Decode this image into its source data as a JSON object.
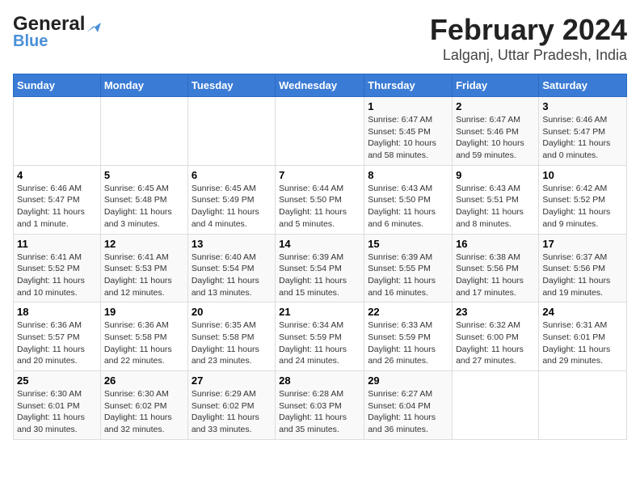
{
  "header": {
    "logo_general": "General",
    "logo_blue": "Blue",
    "title": "February 2024",
    "subtitle": "Lalganj, Uttar Pradesh, India"
  },
  "days_of_week": [
    "Sunday",
    "Monday",
    "Tuesday",
    "Wednesday",
    "Thursday",
    "Friday",
    "Saturday"
  ],
  "weeks": [
    [
      {
        "day": "",
        "info": ""
      },
      {
        "day": "",
        "info": ""
      },
      {
        "day": "",
        "info": ""
      },
      {
        "day": "",
        "info": ""
      },
      {
        "day": "1",
        "info": "Sunrise: 6:47 AM\nSunset: 5:45 PM\nDaylight: 10 hours and 58 minutes."
      },
      {
        "day": "2",
        "info": "Sunrise: 6:47 AM\nSunset: 5:46 PM\nDaylight: 10 hours and 59 minutes."
      },
      {
        "day": "3",
        "info": "Sunrise: 6:46 AM\nSunset: 5:47 PM\nDaylight: 11 hours and 0 minutes."
      }
    ],
    [
      {
        "day": "4",
        "info": "Sunrise: 6:46 AM\nSunset: 5:47 PM\nDaylight: 11 hours and 1 minute."
      },
      {
        "day": "5",
        "info": "Sunrise: 6:45 AM\nSunset: 5:48 PM\nDaylight: 11 hours and 3 minutes."
      },
      {
        "day": "6",
        "info": "Sunrise: 6:45 AM\nSunset: 5:49 PM\nDaylight: 11 hours and 4 minutes."
      },
      {
        "day": "7",
        "info": "Sunrise: 6:44 AM\nSunset: 5:50 PM\nDaylight: 11 hours and 5 minutes."
      },
      {
        "day": "8",
        "info": "Sunrise: 6:43 AM\nSunset: 5:50 PM\nDaylight: 11 hours and 6 minutes."
      },
      {
        "day": "9",
        "info": "Sunrise: 6:43 AM\nSunset: 5:51 PM\nDaylight: 11 hours and 8 minutes."
      },
      {
        "day": "10",
        "info": "Sunrise: 6:42 AM\nSunset: 5:52 PM\nDaylight: 11 hours and 9 minutes."
      }
    ],
    [
      {
        "day": "11",
        "info": "Sunrise: 6:41 AM\nSunset: 5:52 PM\nDaylight: 11 hours and 10 minutes."
      },
      {
        "day": "12",
        "info": "Sunrise: 6:41 AM\nSunset: 5:53 PM\nDaylight: 11 hours and 12 minutes."
      },
      {
        "day": "13",
        "info": "Sunrise: 6:40 AM\nSunset: 5:54 PM\nDaylight: 11 hours and 13 minutes."
      },
      {
        "day": "14",
        "info": "Sunrise: 6:39 AM\nSunset: 5:54 PM\nDaylight: 11 hours and 15 minutes."
      },
      {
        "day": "15",
        "info": "Sunrise: 6:39 AM\nSunset: 5:55 PM\nDaylight: 11 hours and 16 minutes."
      },
      {
        "day": "16",
        "info": "Sunrise: 6:38 AM\nSunset: 5:56 PM\nDaylight: 11 hours and 17 minutes."
      },
      {
        "day": "17",
        "info": "Sunrise: 6:37 AM\nSunset: 5:56 PM\nDaylight: 11 hours and 19 minutes."
      }
    ],
    [
      {
        "day": "18",
        "info": "Sunrise: 6:36 AM\nSunset: 5:57 PM\nDaylight: 11 hours and 20 minutes."
      },
      {
        "day": "19",
        "info": "Sunrise: 6:36 AM\nSunset: 5:58 PM\nDaylight: 11 hours and 22 minutes."
      },
      {
        "day": "20",
        "info": "Sunrise: 6:35 AM\nSunset: 5:58 PM\nDaylight: 11 hours and 23 minutes."
      },
      {
        "day": "21",
        "info": "Sunrise: 6:34 AM\nSunset: 5:59 PM\nDaylight: 11 hours and 24 minutes."
      },
      {
        "day": "22",
        "info": "Sunrise: 6:33 AM\nSunset: 5:59 PM\nDaylight: 11 hours and 26 minutes."
      },
      {
        "day": "23",
        "info": "Sunrise: 6:32 AM\nSunset: 6:00 PM\nDaylight: 11 hours and 27 minutes."
      },
      {
        "day": "24",
        "info": "Sunrise: 6:31 AM\nSunset: 6:01 PM\nDaylight: 11 hours and 29 minutes."
      }
    ],
    [
      {
        "day": "25",
        "info": "Sunrise: 6:30 AM\nSunset: 6:01 PM\nDaylight: 11 hours and 30 minutes."
      },
      {
        "day": "26",
        "info": "Sunrise: 6:30 AM\nSunset: 6:02 PM\nDaylight: 11 hours and 32 minutes."
      },
      {
        "day": "27",
        "info": "Sunrise: 6:29 AM\nSunset: 6:02 PM\nDaylight: 11 hours and 33 minutes."
      },
      {
        "day": "28",
        "info": "Sunrise: 6:28 AM\nSunset: 6:03 PM\nDaylight: 11 hours and 35 minutes."
      },
      {
        "day": "29",
        "info": "Sunrise: 6:27 AM\nSunset: 6:04 PM\nDaylight: 11 hours and 36 minutes."
      },
      {
        "day": "",
        "info": ""
      },
      {
        "day": "",
        "info": ""
      }
    ]
  ]
}
